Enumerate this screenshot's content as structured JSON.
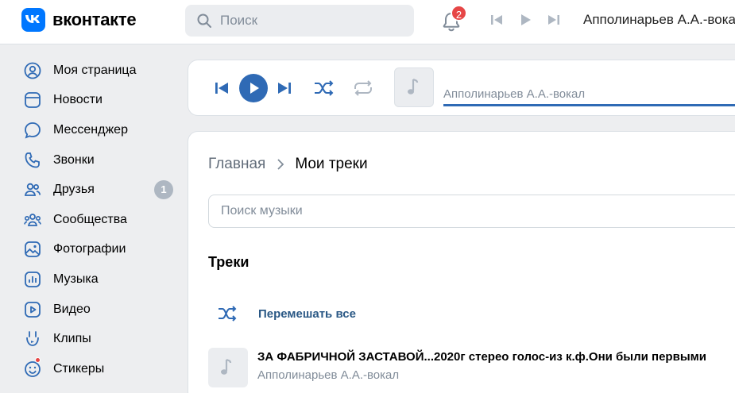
{
  "header": {
    "logo_text": "вконтакте",
    "search_placeholder": "Поиск",
    "notifications_count": "2",
    "now_playing": "Апполинарьев А.А.-вокал"
  },
  "sidebar": {
    "items": [
      {
        "label": "Моя страница",
        "icon": "user-circle-icon"
      },
      {
        "label": "Новости",
        "icon": "news-icon"
      },
      {
        "label": "Мессенджер",
        "icon": "message-icon"
      },
      {
        "label": "Звонки",
        "icon": "phone-icon"
      },
      {
        "label": "Друзья",
        "icon": "friends-icon",
        "count": "1"
      },
      {
        "label": "Сообщества",
        "icon": "communities-icon"
      },
      {
        "label": "Фотографии",
        "icon": "photos-icon"
      },
      {
        "label": "Музыка",
        "icon": "music-icon"
      },
      {
        "label": "Видео",
        "icon": "video-icon"
      },
      {
        "label": "Клипы",
        "icon": "clips-icon"
      },
      {
        "label": "Стикеры",
        "icon": "stickers-icon"
      }
    ]
  },
  "player": {
    "track_title": "Апполинарьев А.А.-вокал",
    "accent": "#2f6ab5"
  },
  "main": {
    "breadcrumb_home": "Главная",
    "breadcrumb_current": "Мои треки",
    "search_placeholder": "Поиск музыки",
    "section_title": "Треки",
    "shuffle_label": "Перемешать все",
    "tracks": [
      {
        "title": "ЗА ФАБРИЧНОЙ ЗАСТАВОЙ...2020г стерео голос-из к.ф.Они были первыми",
        "artist": "Апполинарьев А.А.-вокал"
      }
    ]
  },
  "colors": {
    "brand": "#0077ff",
    "link": "#2a5885",
    "muted": "#818c99",
    "badge_red": "#e64646"
  }
}
